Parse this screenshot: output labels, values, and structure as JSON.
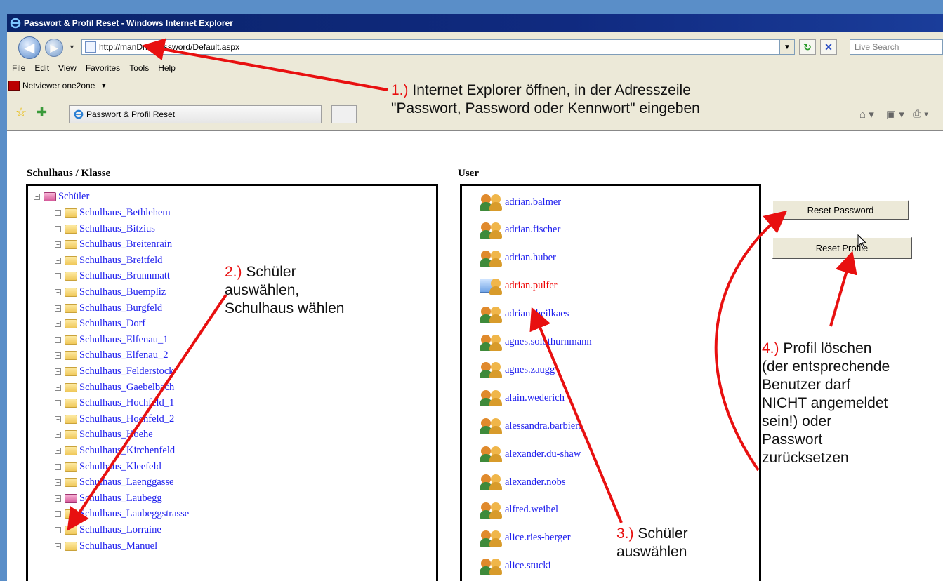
{
  "window": {
    "title": "Passwort & Profil Reset - Windows Internet Explorer"
  },
  "address_bar": {
    "url": "http://manDn1/password/Default.aspx",
    "search_placeholder": "Live Search"
  },
  "menu": [
    "File",
    "Edit",
    "View",
    "Favorites",
    "Tools",
    "Help"
  ],
  "links_bar": {
    "item": "Netviewer one2one"
  },
  "tab": {
    "label": "Passwort & Profil Reset"
  },
  "tree": {
    "header": "Schulhaus / Klasse",
    "root": "Schüler",
    "items": [
      "Schulhaus_Bethlehem",
      "Schulhaus_Bitzius",
      "Schulhaus_Breitenrain",
      "Schulhaus_Breitfeld",
      "Schulhaus_Brunnmatt",
      "Schulhaus_Buempliz",
      "Schulhaus_Burgfeld",
      "Schulhaus_Dorf",
      "Schulhaus_Elfenau_1",
      "Schulhaus_Elfenau_2",
      "Schulhaus_Felderstock",
      "Schulhaus_Gaebelbach",
      "Schulhaus_Hochfeld_1",
      "Schulhaus_Hochfeld_2",
      "Schulhaus_Hoehe",
      "Schulhaus_Kirchenfeld",
      "Schulhaus_Kleefeld",
      "Schulhaus_Laenggasse",
      "Schulhaus_Laubegg",
      "Schulhaus_Laubeggstrasse",
      "Schulhaus_Lorraine",
      "Schulhaus_Manuel"
    ]
  },
  "users": {
    "header": "User",
    "items": [
      "adrian.balmer",
      "adrian.fischer",
      "adrian.huber",
      "adrian.pulfer",
      "adrian.theilkaes",
      "agnes.solothurnmann",
      "agnes.zaugg",
      "alain.wederich",
      "alessandra.barbieri",
      "alexander.du-shaw",
      "alexander.nobs",
      "alfred.weibel",
      "alice.ries-berger",
      "alice.stucki"
    ],
    "selected": "adrian.pulfer"
  },
  "buttons": {
    "reset_password": "Reset Password",
    "reset_profile": "Reset Profile"
  },
  "annotations": {
    "step1": {
      "num": "1.)",
      "line1": "Internet Explorer öffnen, in der Adresszeile",
      "line2": "\"Passwort, Password oder Kennwort\" eingeben"
    },
    "step2": {
      "num": "2.)",
      "line1": "Schüler",
      "line2": "auswählen,",
      "line3": "Schulhaus wählen"
    },
    "step3": {
      "num": "3.)",
      "line1": "Schüler",
      "line2": "auswählen"
    },
    "step4": {
      "num": "4.)",
      "line1": "Profil löschen",
      "line2": "(der entsprechende",
      "line3": "Benutzer darf",
      "line4": "NICHT angemeldet",
      "line5": "sein!) oder",
      "line6": "Passwort",
      "line7": "zurücksetzen"
    }
  },
  "colors": {
    "link": "#2020ee",
    "selected": "#e00000",
    "annotation": "#e81010",
    "titlebar": "#0a246a"
  }
}
